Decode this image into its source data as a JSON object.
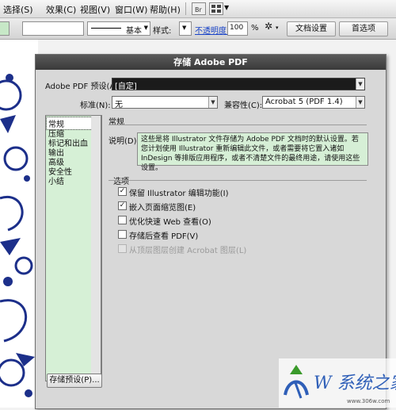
{
  "menubar": {
    "items": [
      "选择(S)",
      "效果(C)",
      "视图(V)",
      "窗口(W)",
      "帮助(H)"
    ]
  },
  "controlbar": {
    "stroke_style": "基本",
    "style_label": "样式:",
    "opacity_label": "不透明度:",
    "opacity_value": "100",
    "opacity_unit": "%",
    "doc_setup_button": "文档设置",
    "prefs_button": "首选项"
  },
  "dialog": {
    "title": "存储 Adobe PDF",
    "preset_label": "Adobe PDF 预设(A):",
    "preset_value": "[自定]",
    "standard_label": "标准(N):",
    "standard_value": "无",
    "compat_label": "兼容性(C):",
    "compat_value": "Acrobat 5 (PDF 1.4)",
    "categories": [
      "常规",
      "压缩",
      "标记和出血",
      "输出",
      "高级",
      "安全性",
      "小结"
    ],
    "section_title": "常规",
    "desc_label": "说明(D):",
    "description": "这些是将 Illustrator 文件存储为 Adobe PDF 文档时的默认设置。若您计划使用 Illustrator 重新编辑此文件，或者需要将它置入诸如 InDesign 等排版应用程序，或者不清楚文件的最终用途，请使用这些设置。",
    "options_title": "选项",
    "options": [
      {
        "label": "保留 Illustrator 编辑功能(I)",
        "checked": true
      },
      {
        "label": "嵌入页面缩览图(E)",
        "checked": true
      },
      {
        "label": "优化快速 Web 查看(O)",
        "checked": false
      },
      {
        "label": "存储后查看 PDF(V)",
        "checked": false
      },
      {
        "label": "从顶层图层创建 Acrobat 图层(L)",
        "checked": false,
        "disabled": true
      }
    ],
    "save_preset_button": "存储预设(P)..."
  },
  "watermark": {
    "brand": "W 系统之家",
    "url": "www.306w.com"
  },
  "colors": {
    "panel_green": "#d6f0d6",
    "desc_green": "#d6efd6",
    "title_bar": "#3a3a3a",
    "opacity_link": "#1a44c8",
    "artwork_blue": "#1c2f8a"
  }
}
